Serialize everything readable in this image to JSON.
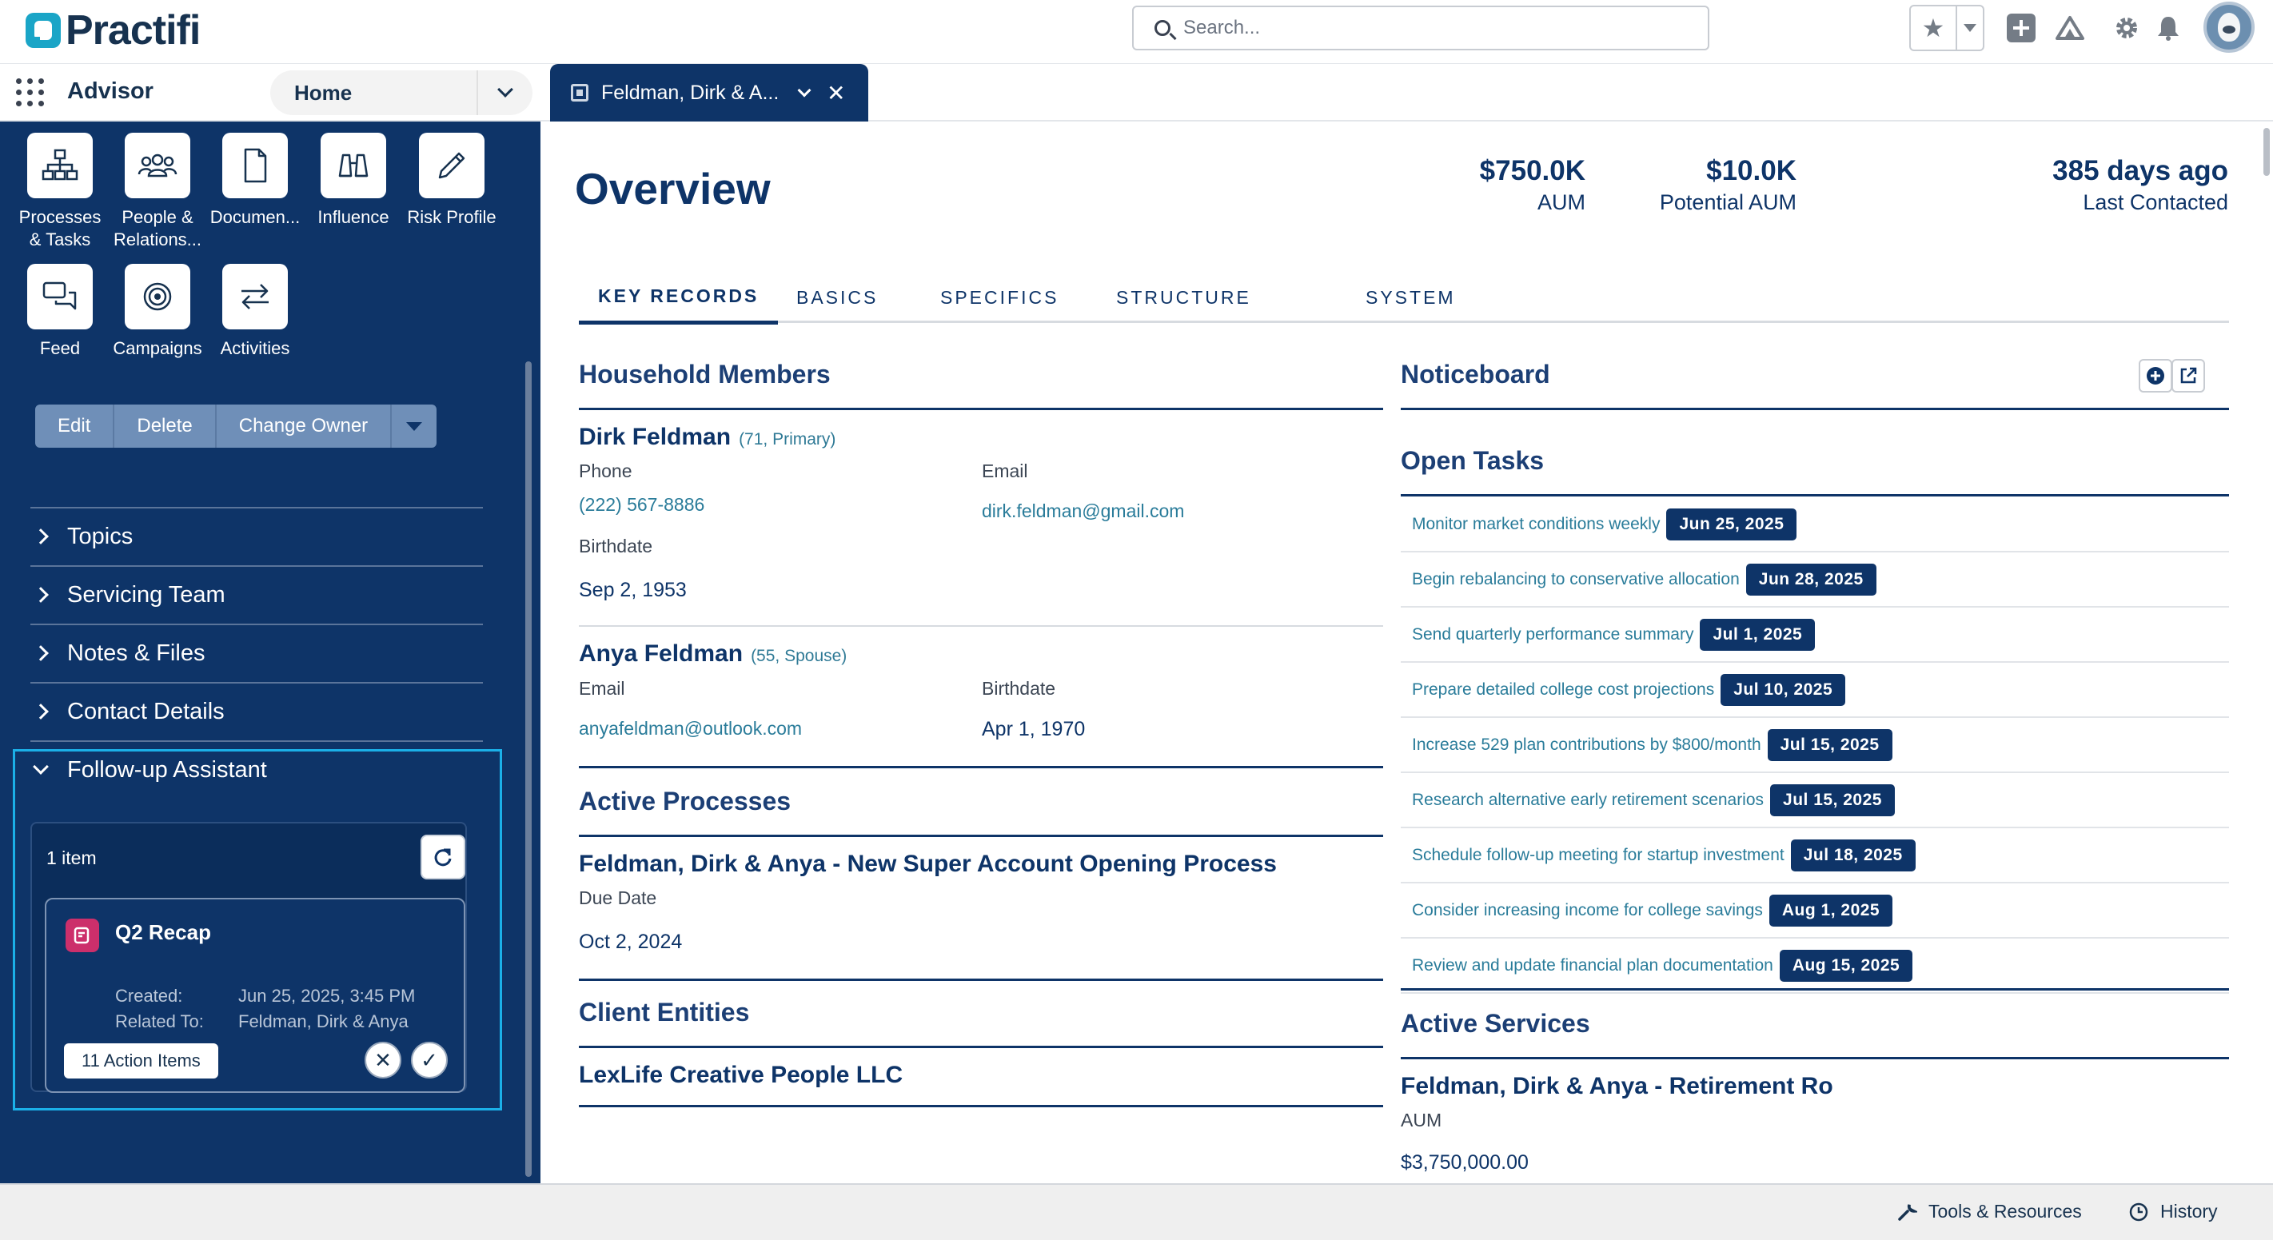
{
  "header": {
    "logo_text": "Practifi",
    "search_placeholder": "Search...",
    "icons": [
      "star-icon",
      "chevron-down-icon",
      "add-icon",
      "trailhead-icon",
      "gear-icon",
      "bell-icon",
      "avatar"
    ]
  },
  "nav": {
    "app_name": "Advisor",
    "selected": "Home",
    "tab_label": "Feldman, Dirk & A..."
  },
  "sidebar": {
    "quick_actions": [
      {
        "label1": "Processes",
        "label2": "& Tasks"
      },
      {
        "label1": "People &",
        "label2": "Relations..."
      },
      {
        "label1": "Documen...",
        "label2": ""
      },
      {
        "label1": "Influence",
        "label2": ""
      },
      {
        "label1": "Risk Profile",
        "label2": ""
      },
      {
        "label1": "Feed",
        "label2": ""
      },
      {
        "label1": "Campaigns",
        "label2": ""
      },
      {
        "label1": "Activities",
        "label2": ""
      }
    ],
    "actions": {
      "edit": "Edit",
      "delete": "Delete",
      "change_owner": "Change Owner"
    },
    "sections": [
      "Topics",
      "Servicing Team",
      "Notes & Files",
      "Contact Details",
      "Follow-up Assistant"
    ],
    "followup": {
      "count": "1 item",
      "card": {
        "title": "Q2 Recap",
        "created_label": "Created:",
        "created_value": "Jun 25, 2025, 3:45 PM",
        "related_label": "Related To:",
        "related_value": "Feldman, Dirk & Anya",
        "action_items": "11 Action Items"
      }
    }
  },
  "main": {
    "title": "Overview",
    "metrics": [
      {
        "value": "$750.0K",
        "label": "AUM"
      },
      {
        "value": "$10.0K",
        "label": "Potential AUM"
      },
      {
        "value": "385 days ago",
        "label": "Last Contacted"
      }
    ],
    "tabs": [
      "KEY RECORDS",
      "BASICS",
      "SPECIFICS",
      "STRUCTURE",
      "SYSTEM"
    ],
    "household": {
      "title": "Household Members",
      "members": [
        {
          "name": "Dirk Feldman",
          "meta": "(71, Primary)",
          "phone_label": "Phone",
          "phone": "(222) 567-8886",
          "email_label": "Email",
          "email": "dirk.feldman@gmail.com",
          "birth_label": "Birthdate",
          "birthdate": "Sep 2, 1953"
        },
        {
          "name": "Anya Feldman",
          "meta": "(55, Spouse)",
          "email_label": "Email",
          "email": "anyafeldman@outlook.com",
          "birth_label": "Birthdate",
          "birthdate": "Apr 1, 1970"
        }
      ]
    },
    "processes": {
      "title": "Active Processes",
      "name": "Feldman, Dirk & Anya - New Super Account Opening Process",
      "due_label": "Due Date",
      "due": "Oct 2, 2024"
    },
    "entities": {
      "title": "Client Entities",
      "name": "LexLife Creative People LLC"
    },
    "noticeboard": {
      "title": "Noticeboard"
    },
    "open_tasks": {
      "title": "Open Tasks",
      "items": [
        {
          "name": "Monitor market conditions weekly",
          "date": "Jun 25, 2025"
        },
        {
          "name": "Begin rebalancing to conservative allocation",
          "date": "Jun 28, 2025"
        },
        {
          "name": "Send quarterly performance summary",
          "date": "Jul 1, 2025"
        },
        {
          "name": "Prepare detailed college cost projections",
          "date": "Jul 10, 2025"
        },
        {
          "name": "Increase 529 plan contributions by $800/month",
          "date": "Jul 15, 2025"
        },
        {
          "name": "Research alternative early retirement scenarios",
          "date": "Jul 15, 2025"
        },
        {
          "name": "Schedule follow-up meeting for startup investment",
          "date": "Jul 18, 2025"
        },
        {
          "name": "Consider increasing income for college savings",
          "date": "Aug 1, 2025"
        },
        {
          "name": "Review and update financial plan documentation",
          "date": "Aug 15, 2025"
        }
      ]
    },
    "services": {
      "title": "Active Services",
      "name": "Feldman, Dirk & Anya - Retirement Ro",
      "aum_label": "AUM",
      "aum": "$3,750,000.00"
    }
  },
  "footer": {
    "tools": "Tools & Resources",
    "history": "History"
  },
  "colors": {
    "navy": "#0e3468",
    "accent_link": "#2a7c9a",
    "focus_outline": "#1bb0e8",
    "recap_icon": "#cc2f6b"
  }
}
